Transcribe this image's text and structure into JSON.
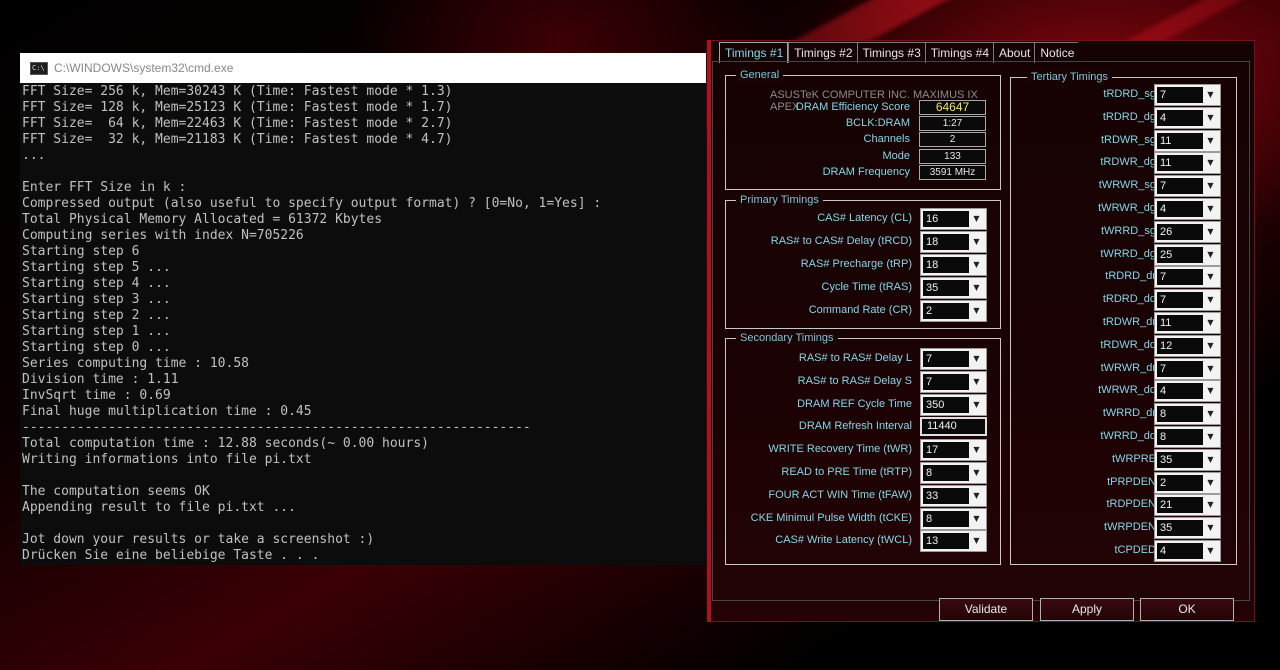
{
  "cmd": {
    "title": "C:\\WINDOWS\\system32\\cmd.exe",
    "icon_text": "C:\\",
    "lines": [
      "FFT Size= 256 k, Mem=30243 K (Time: Fastest mode * 1.3)",
      "FFT Size= 128 k, Mem=25123 K (Time: Fastest mode * 1.7)",
      "FFT Size=  64 k, Mem=22463 K (Time: Fastest mode * 2.7)",
      "FFT Size=  32 k, Mem=21183 K (Time: Fastest mode * 4.7)",
      "...",
      "",
      "Enter FFT Size in k :",
      "Compressed output (also useful to specify output format) ? [0=No, 1=Yes] :",
      "Total Physical Memory Allocated = 61372 Kbytes",
      "Computing series with index N=705226",
      "Starting step 6",
      "Starting step 5 ...",
      "Starting step 4 ...",
      "Starting step 3 ...",
      "Starting step 2 ...",
      "Starting step 1 ...",
      "Starting step 0 ...",
      "Series computing time : 10.58",
      "Division time : 1.11",
      "InvSqrt time : 0.69",
      "Final huge multiplication time : 0.45",
      "-----------------------------------------------------------------",
      "Total computation time : 12.88 seconds(~ 0.00 hours)",
      "Writing informations into file pi.txt",
      "",
      "The computation seems OK",
      "Appending result to file pi.txt ...",
      "",
      "Jot down your results or take a screenshot :)",
      "Drücken Sie eine beliebige Taste . . ."
    ]
  },
  "timings": {
    "tabs": [
      "Timings #1",
      "Timings #2",
      "Timings #3",
      "Timings #4",
      "About",
      "Notice"
    ],
    "general": {
      "title": "General",
      "board": "ASUSTeK COMPUTER INC. MAXIMUS IX APEX",
      "fields": [
        {
          "label": "DRAM Efficiency Score",
          "value": "64647"
        },
        {
          "label": "BCLK:DRAM",
          "value": "1:27"
        },
        {
          "label": "Channels",
          "value": "2"
        },
        {
          "label": "Mode",
          "value": "133"
        },
        {
          "label": "DRAM Frequency",
          "value": "3591 MHz"
        }
      ]
    },
    "primary": {
      "title": "Primary Timings",
      "fields": [
        {
          "label": "CAS# Latency (CL)",
          "value": "16"
        },
        {
          "label": "RAS# to CAS# Delay (tRCD)",
          "value": "18"
        },
        {
          "label": "RAS# Precharge (tRP)",
          "value": "18"
        },
        {
          "label": "Cycle Time (tRAS)",
          "value": "35"
        },
        {
          "label": "Command Rate (CR)",
          "value": "2"
        }
      ]
    },
    "secondary": {
      "title": "Secondary Timings",
      "fields": [
        {
          "label": "RAS# to RAS# Delay L",
          "value": "7"
        },
        {
          "label": "RAS# to RAS# Delay S",
          "value": "7"
        },
        {
          "label": "DRAM REF Cycle Time",
          "value": "350"
        },
        {
          "label": "DRAM Refresh Interval",
          "value": "11440"
        },
        {
          "label": "WRITE Recovery Time (tWR)",
          "value": "17"
        },
        {
          "label": "READ to PRE Time (tRTP)",
          "value": "8"
        },
        {
          "label": "FOUR ACT WIN Time (tFAW)",
          "value": "33"
        },
        {
          "label": "CKE Minimul Pulse Width (tCKE)",
          "value": "8"
        },
        {
          "label": "CAS# Write Latency (tWCL)",
          "value": "13"
        }
      ]
    },
    "tertiary": {
      "title": "Tertiary Timings",
      "fields": [
        {
          "label": "tRDRD_sg",
          "value": "7"
        },
        {
          "label": "tRDRD_dg",
          "value": "4"
        },
        {
          "label": "tRDWR_sg",
          "value": "11"
        },
        {
          "label": "tRDWR_dg",
          "value": "11"
        },
        {
          "label": "tWRWR_sg",
          "value": "7"
        },
        {
          "label": "tWRWR_dg",
          "value": "4"
        },
        {
          "label": "tWRRD_sg",
          "value": "26"
        },
        {
          "label": "tWRRD_dg",
          "value": "25"
        },
        {
          "label": "tRDRD_dr",
          "value": "7"
        },
        {
          "label": "tRDRD_dd",
          "value": "7"
        },
        {
          "label": "tRDWR_dr",
          "value": "11"
        },
        {
          "label": "tRDWR_dd",
          "value": "12"
        },
        {
          "label": "tWRWR_dr",
          "value": "7"
        },
        {
          "label": "tWRWR_dd",
          "value": "4"
        },
        {
          "label": "tWRRD_dr",
          "value": "8"
        },
        {
          "label": "tWRRD_dd",
          "value": "8"
        },
        {
          "label": "tWRPRE",
          "value": "35"
        },
        {
          "label": "tPRPDEN",
          "value": "2"
        },
        {
          "label": "tRDPDEN",
          "value": "21"
        },
        {
          "label": "tWRPDEN",
          "value": "35"
        },
        {
          "label": "tCPDED",
          "value": "4"
        }
      ]
    },
    "buttons": {
      "validate": "Validate",
      "apply": "Apply",
      "ok": "OK"
    }
  }
}
